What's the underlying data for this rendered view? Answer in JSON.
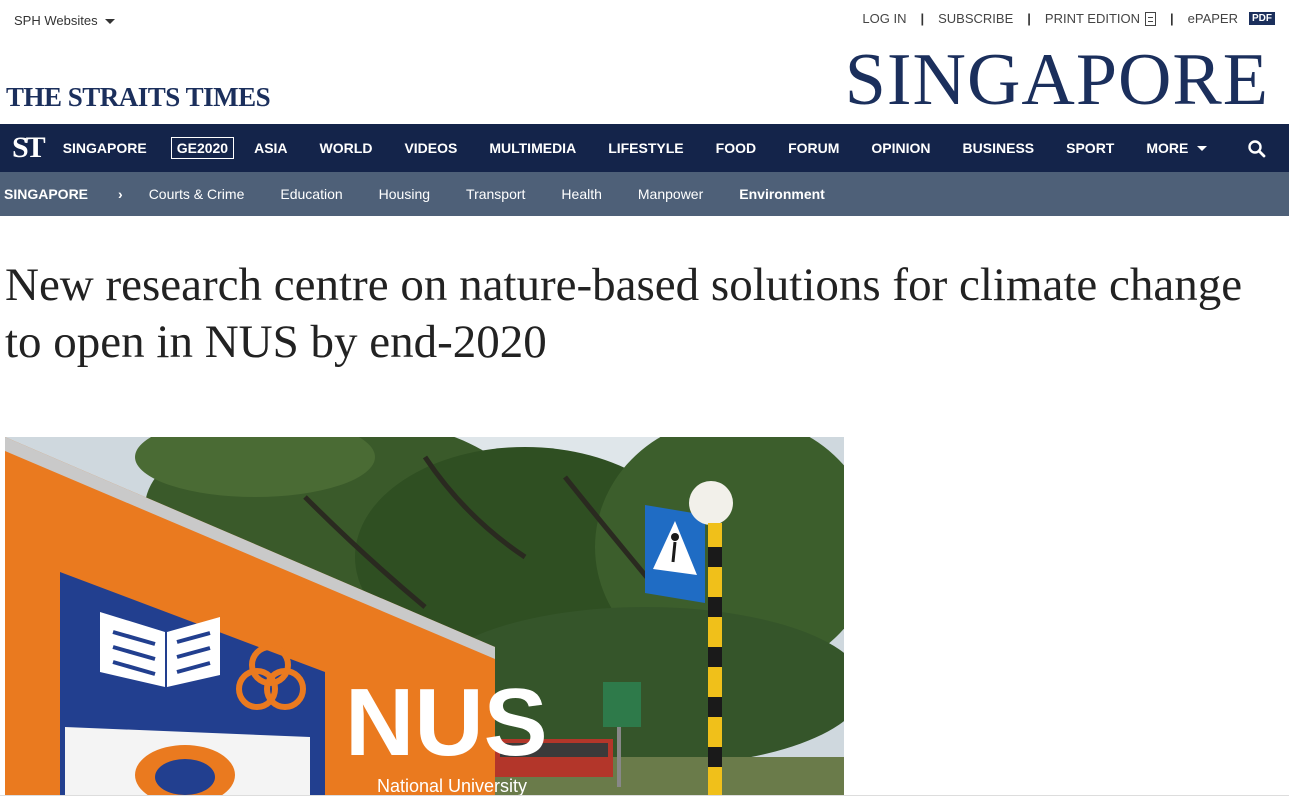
{
  "utility": {
    "sph_label": "SPH Websites",
    "links": [
      {
        "label": "LOG IN"
      },
      {
        "label": "SUBSCRIBE"
      },
      {
        "label": "PRINT EDITION"
      },
      {
        "label": "ePAPER",
        "badge": "PDF"
      }
    ]
  },
  "masthead": {
    "logo": "THE STRAITS TIMES",
    "section": "SINGAPORE",
    "brand_color": "#1b2f5c"
  },
  "primary_nav": {
    "st_mark": "ST",
    "items": [
      "SINGAPORE",
      "GE2020",
      "ASIA",
      "WORLD",
      "VIDEOS",
      "MULTIMEDIA",
      "LIFESTYLE",
      "FOOD",
      "FORUM",
      "OPINION",
      "BUSINESS",
      "SPORT"
    ],
    "more_label": "MORE",
    "search_icon": "search-icon",
    "bg_color": "#14244a"
  },
  "sub_nav": {
    "section": "SINGAPORE",
    "items": [
      "Courts & Crime",
      "Education",
      "Housing",
      "Transport",
      "Health",
      "Manpower",
      "Environment"
    ],
    "active": "Environment",
    "bg_color": "#4e6078"
  },
  "article": {
    "headline": "New research centre on nature-based solutions for climate change to open in NUS by end-2020"
  },
  "photo": {
    "sign_text": "NUS",
    "sign_subtext": "National University"
  }
}
